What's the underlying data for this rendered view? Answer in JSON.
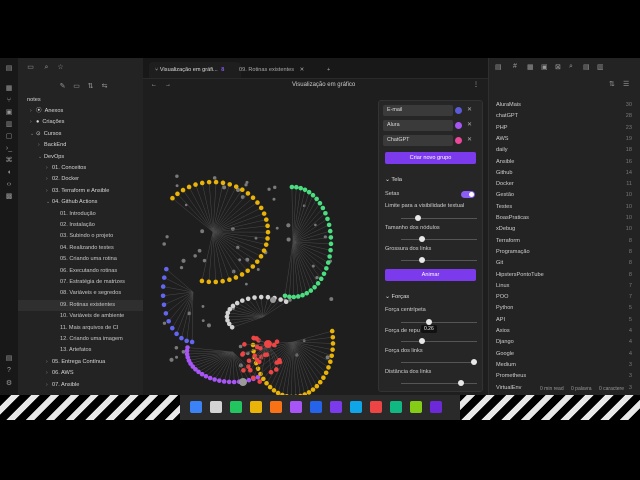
{
  "sidebar": {
    "vault_name": "notes",
    "tree": [
      {
        "label": "Anexos",
        "chev": "›",
        "icon": "⦿"
      },
      {
        "label": "Criações",
        "chev": "›",
        "icon": "●"
      },
      {
        "label": "Cursos",
        "chev": "⌄",
        "icon": "⊙"
      },
      {
        "label": "BackEnd",
        "chev": "›",
        "icon": ""
      },
      {
        "label": "DevOps",
        "chev": "⌄",
        "icon": ""
      },
      {
        "label": "01. Conceitos",
        "chev": "›",
        "icon": ""
      },
      {
        "label": "02. Docker",
        "chev": "›",
        "icon": ""
      },
      {
        "label": "03. Terraform e Ansible",
        "chev": "›",
        "icon": ""
      },
      {
        "label": "04. Github Actions",
        "chev": "⌄",
        "icon": ""
      },
      {
        "label": "01. Introdução",
        "chev": "",
        "icon": ""
      },
      {
        "label": "02. Instalação",
        "chev": "",
        "icon": ""
      },
      {
        "label": "03. Subindo o projeto",
        "chev": "",
        "icon": ""
      },
      {
        "label": "04. Realizando testes",
        "chev": "",
        "icon": ""
      },
      {
        "label": "05. Criando uma rotina",
        "chev": "",
        "icon": ""
      },
      {
        "label": "06. Executando rotinas",
        "chev": "",
        "icon": ""
      },
      {
        "label": "07. Estratégia de matrizes",
        "chev": "",
        "icon": ""
      },
      {
        "label": "08. Variáveis e segredos",
        "chev": "",
        "icon": ""
      },
      {
        "label": "09. Rotinas existentes",
        "chev": "",
        "icon": ""
      },
      {
        "label": "10. Variáveis de ambiente",
        "chev": "",
        "icon": ""
      },
      {
        "label": "11. Mais arquivos de CI",
        "chev": "",
        "icon": ""
      },
      {
        "label": "12. Criando uma imagem",
        "chev": "",
        "icon": ""
      },
      {
        "label": "13. Artefatos",
        "chev": "",
        "icon": ""
      },
      {
        "label": "05. Entrega Contínua",
        "chev": "›",
        "icon": ""
      },
      {
        "label": "06. AWS",
        "chev": "›",
        "icon": ""
      },
      {
        "label": "07. Ansible",
        "chev": "›",
        "icon": ""
      }
    ]
  },
  "tabs": [
    {
      "label": "Visualização em gráfi...",
      "active": true
    },
    {
      "label": "09. Rotinas existentes",
      "active": false
    }
  ],
  "tab_new": "+",
  "view": {
    "title": "Visualização em gráfico",
    "back": "←",
    "forward": "→",
    "more": "⋮"
  },
  "graph_panel": {
    "groups": [
      {
        "query": "E-mail",
        "color": "#5b5bd6"
      },
      {
        "query": "Alura",
        "color": "#a855f7"
      },
      {
        "query": "ChatGPT",
        "color": "#ec4899"
      }
    ],
    "new_group_label": "Criar novo grupo",
    "display_header": "Tela",
    "arrows_label": "Setas",
    "arrows_on": true,
    "text_threshold_label": "Limite para a visibilidade textual",
    "text_threshold": 0.2,
    "node_size_label": "Tamanho dos nódulos",
    "node_size": 0.25,
    "link_thickness_label": "Grossura dos links",
    "link_thickness": 0.25,
    "animate_label": "Animar",
    "forces_header": "Forças",
    "center_force_label": "Força centrípeta",
    "center_force": 0.36,
    "repel_force_label": "Força de repu",
    "repel_force": 0.26,
    "repel_tooltip": "0.26",
    "link_force_label": "Força dos links",
    "link_force": 1.0,
    "link_distance_label": "Distância dos links",
    "link_distance": 0.82
  },
  "tags": [
    {
      "name": "AluraMais",
      "count": "30"
    },
    {
      "name": "chatGPT",
      "count": "28"
    },
    {
      "name": "PHP",
      "count": "23"
    },
    {
      "name": "AWS",
      "count": "19"
    },
    {
      "name": "daily",
      "count": "18"
    },
    {
      "name": "Ansible",
      "count": "16"
    },
    {
      "name": "Github",
      "count": "14"
    },
    {
      "name": "Docker",
      "count": "11"
    },
    {
      "name": "Gestão",
      "count": "10"
    },
    {
      "name": "Testes",
      "count": "10"
    },
    {
      "name": "BoasPraticas",
      "count": "10"
    },
    {
      "name": "xDebug",
      "count": "10"
    },
    {
      "name": "Terraform",
      "count": "8"
    },
    {
      "name": "Programação",
      "count": "8"
    },
    {
      "name": "Git",
      "count": "8"
    },
    {
      "name": "HipstersPontoTube",
      "count": "8"
    },
    {
      "name": "Linux",
      "count": "7"
    },
    {
      "name": "POO",
      "count": "7"
    },
    {
      "name": "Python",
      "count": "5"
    },
    {
      "name": "API",
      "count": "5"
    },
    {
      "name": "Axios",
      "count": "4"
    },
    {
      "name": "Django",
      "count": "4"
    },
    {
      "name": "Google",
      "count": "4"
    },
    {
      "name": "Medium",
      "count": "3"
    },
    {
      "name": "Prometheus",
      "count": "3"
    },
    {
      "name": "VirtualEnv",
      "count": "3"
    }
  ],
  "status": {
    "read": "0 min read",
    "words": "0 palavra",
    "chars": "0 caractere"
  },
  "colors": {
    "accent": "#7c3aed",
    "yellow": "#eab308",
    "green": "#4ade80",
    "purple": "#a855f7",
    "red": "#ef4444",
    "blue": "#6366f1",
    "grey": "#9ca3af"
  }
}
